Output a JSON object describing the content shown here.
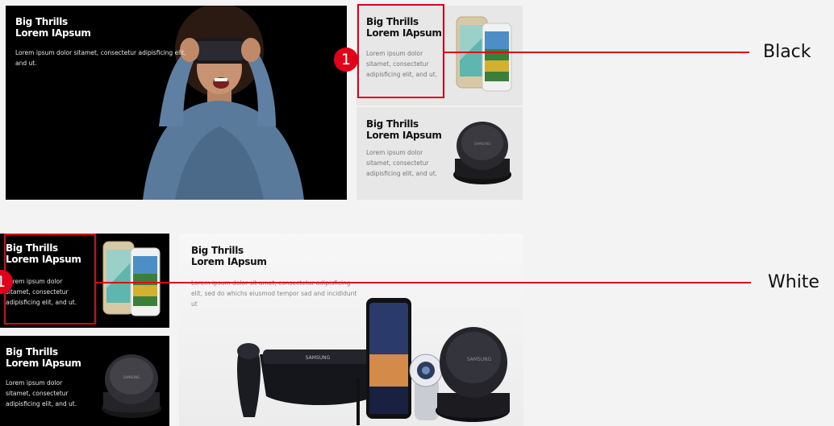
{
  "black_section": {
    "hero": {
      "title_1": "Big Thrills",
      "title_2": "Lorem IApsum",
      "desc_1": "Lorem ipsum dolor sitamet, consectetur adipisficing elit,",
      "desc_2": "and ut."
    },
    "card_phones": {
      "title_1": "Big Thrills",
      "title_2": "Lorem IApsum",
      "desc_1": "Lorem ipsum dolor",
      "desc_2": "sitamet, consectetur",
      "desc_3": "adipisficing elit, and ut."
    },
    "card_dock": {
      "title_1": "Big Thrills",
      "title_2": "Lorem IApsum",
      "desc_1": "Lorem ipsum dolor",
      "desc_2": "sitamet, consectetur",
      "desc_3": "adipisficing elit, and ut.",
      "device_brand": "SAMSUNG"
    },
    "annotation_number": "1",
    "annotation_label": "Black"
  },
  "white_section": {
    "card_phones": {
      "title_1": "Big Thrills",
      "title_2": "Lorem IApsum",
      "desc_1": "Lorem ipsum dolor",
      "desc_2": "sitamet, consectetur",
      "desc_3": "adipisficing elit, and ut."
    },
    "card_dock": {
      "title_1": "Big Thrills",
      "title_2": "Lorem IApsum",
      "desc_1": "Lorem ipsum dolor",
      "desc_2": "sitamet, consectetur",
      "desc_3": "adipisficing elit, and ut.",
      "device_brand": "SAMSUNG"
    },
    "hero": {
      "title_1": "Big Thrills",
      "title_2": "Lorem IApsum",
      "desc_1": "Lorem ipsum dolor sit amet, consectetur adipisficing",
      "desc_2": "elit, sed do whichs eiusmod tempor sad and incididunt",
      "desc_3": "ut",
      "vr_brand": "SAMSUNG",
      "dock_brand": "SAMSUNG"
    },
    "annotation_number": "1",
    "annotation_label": "White"
  },
  "colors": {
    "accent_red": "#e0001b",
    "dark_bg": "#000000",
    "light_bg": "#e7e7e7"
  }
}
